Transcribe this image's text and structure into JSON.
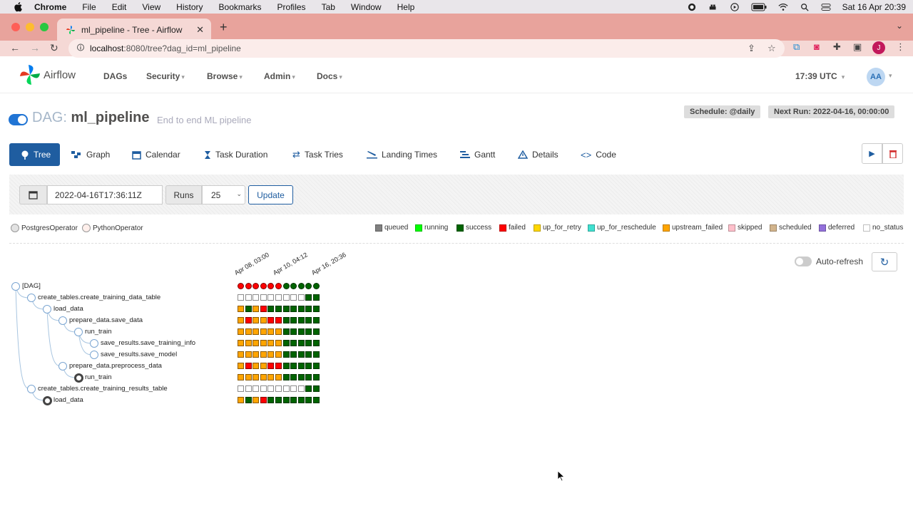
{
  "mac_menubar": {
    "app": "Chrome",
    "menus": [
      "File",
      "Edit",
      "View",
      "History",
      "Bookmarks",
      "Profiles",
      "Tab",
      "Window",
      "Help"
    ],
    "datetime": "Sat 16 Apr  20:39"
  },
  "browser": {
    "tab_title": "ml_pipeline - Tree - Airflow",
    "url_host": "localhost",
    "url_rest": ":8080/tree?dag_id=ml_pipeline",
    "profile_initial": "J"
  },
  "airflow_nav": {
    "brand": "Airflow",
    "items": [
      "DAGs",
      "Security",
      "Browse",
      "Admin",
      "Docs"
    ],
    "clock": "17:39 UTC",
    "user_initials": "AA"
  },
  "dag": {
    "label": "DAG:",
    "name": "ml_pipeline",
    "description": "End to end ML pipeline",
    "schedule": "Schedule: @daily",
    "next_run": "Next Run: 2022-04-16, 00:00:00"
  },
  "view_tabs": [
    "Tree",
    "Graph",
    "Calendar",
    "Task Duration",
    "Task Tries",
    "Landing Times",
    "Gantt",
    "Details",
    "Code"
  ],
  "filters": {
    "base_date": "2022-04-16T17:36:11Z",
    "runs_label": "Runs",
    "runs_value": "25",
    "update_label": "Update"
  },
  "operators": [
    {
      "name": "PostgresOperator",
      "color": "#e2e2e2"
    },
    {
      "name": "PythonOperator",
      "color": "#ffefeb"
    }
  ],
  "states": [
    {
      "name": "queued",
      "color": "#808080"
    },
    {
      "name": "running",
      "color": "#00ff00"
    },
    {
      "name": "success",
      "color": "#006400"
    },
    {
      "name": "failed",
      "color": "#ff0000"
    },
    {
      "name": "up_for_retry",
      "color": "#ffd700"
    },
    {
      "name": "up_for_reschedule",
      "color": "#40e0d0"
    },
    {
      "name": "upstream_failed",
      "color": "#ffa500"
    },
    {
      "name": "skipped",
      "color": "#ffc0cb"
    },
    {
      "name": "scheduled",
      "color": "#d2b48c"
    },
    {
      "name": "deferred",
      "color": "#9370db"
    },
    {
      "name": "no_status",
      "color": "#ffffff"
    }
  ],
  "auto_refresh_label": "Auto-refresh",
  "run_dates": [
    "Apr 08, 03:00",
    "Apr 10, 04:12",
    "Apr 16, 20:36"
  ],
  "tree": [
    {
      "label": "[DAG]",
      "depth": 0,
      "dark": false
    },
    {
      "label": "create_tables.create_training_data_table",
      "depth": 1,
      "dark": false
    },
    {
      "label": "load_data",
      "depth": 2,
      "dark": false
    },
    {
      "label": "prepare_data.save_data",
      "depth": 3,
      "dark": false
    },
    {
      "label": "run_train",
      "depth": 4,
      "dark": false
    },
    {
      "label": "save_results.save_training_info",
      "depth": 5,
      "dark": false
    },
    {
      "label": "save_results.save_model",
      "depth": 5,
      "dark": false
    },
    {
      "label": "prepare_data.preprocess_data",
      "depth": 3,
      "dark": false
    },
    {
      "label": "run_train",
      "depth": 4,
      "dark": true
    },
    {
      "label": "create_tables.create_training_results_table",
      "depth": 1,
      "dark": false
    },
    {
      "label": "load_data",
      "depth": 2,
      "dark": true
    }
  ],
  "grid": [
    [
      "failed",
      "failed",
      "failed",
      "failed",
      "failed",
      "failed",
      "success",
      "success",
      "success",
      "success",
      "success"
    ],
    [
      "no_status",
      "no_status",
      "no_status",
      "no_status",
      "no_status",
      "no_status",
      "no_status",
      "no_status",
      "no_status",
      "success",
      "success"
    ],
    [
      "upstream_failed",
      "success",
      "upstream_failed",
      "failed",
      "success",
      "success",
      "success",
      "success",
      "success",
      "success",
      "success"
    ],
    [
      "upstream_failed",
      "failed",
      "upstream_failed",
      "upstream_failed",
      "failed",
      "failed",
      "success",
      "success",
      "success",
      "success",
      "success"
    ],
    [
      "upstream_failed",
      "upstream_failed",
      "upstream_failed",
      "upstream_failed",
      "upstream_failed",
      "upstream_failed",
      "success",
      "success",
      "success",
      "success",
      "success"
    ],
    [
      "upstream_failed",
      "upstream_failed",
      "upstream_failed",
      "upstream_failed",
      "upstream_failed",
      "upstream_failed",
      "success",
      "success",
      "success",
      "success",
      "success"
    ],
    [
      "upstream_failed",
      "upstream_failed",
      "upstream_failed",
      "upstream_failed",
      "upstream_failed",
      "upstream_failed",
      "success",
      "success",
      "success",
      "success",
      "success"
    ],
    [
      "upstream_failed",
      "failed",
      "upstream_failed",
      "upstream_failed",
      "failed",
      "failed",
      "success",
      "success",
      "success",
      "success",
      "success"
    ],
    [
      "upstream_failed",
      "upstream_failed",
      "upstream_failed",
      "upstream_failed",
      "upstream_failed",
      "upstream_failed",
      "success",
      "success",
      "success",
      "success",
      "success"
    ],
    [
      "no_status",
      "no_status",
      "no_status",
      "no_status",
      "no_status",
      "no_status",
      "no_status",
      "no_status",
      "no_status",
      "success",
      "success"
    ],
    [
      "upstream_failed",
      "success",
      "upstream_failed",
      "failed",
      "success",
      "success",
      "success",
      "success",
      "success",
      "success",
      "success"
    ]
  ]
}
